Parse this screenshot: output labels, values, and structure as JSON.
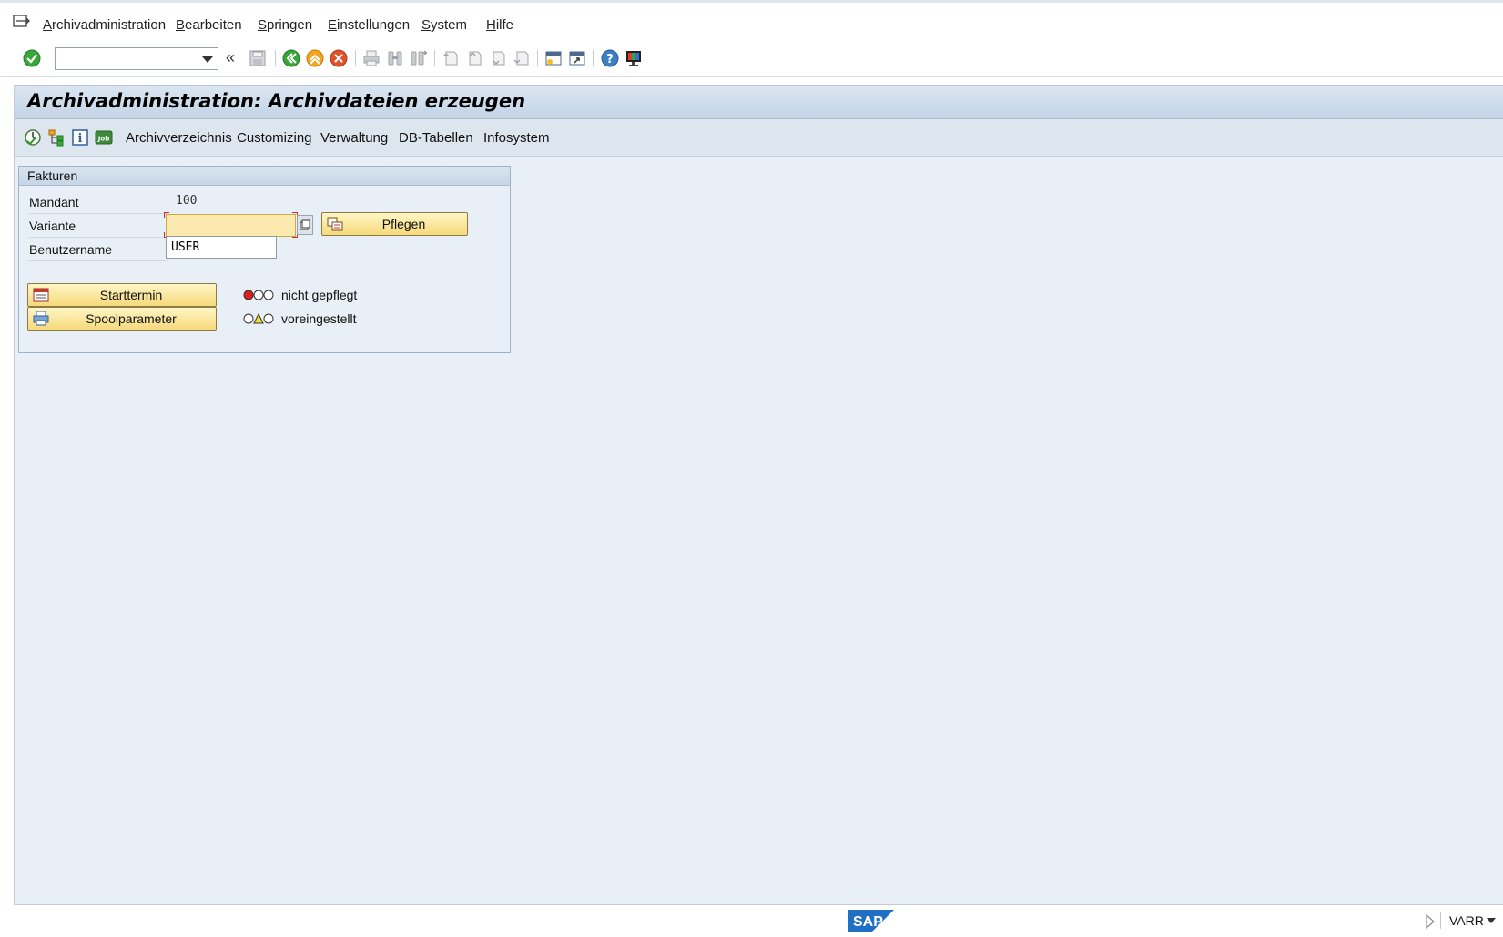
{
  "menu": {
    "items": [
      {
        "first": "A",
        "rest": "rchivadministration"
      },
      {
        "first": "B",
        "rest": "earbeiten"
      },
      {
        "first": "S",
        "rest": "pringen"
      },
      {
        "first": "E",
        "rest": "instellungen"
      },
      {
        "first": "S",
        "rest": "ystem"
      },
      {
        "first": "H",
        "rest": "ilfe"
      }
    ]
  },
  "system_toolbar": {
    "command_value": "",
    "collapse_glyph": "«"
  },
  "page": {
    "title": "Archivadministration: Archivdateien erzeugen"
  },
  "app_toolbar": {
    "links": [
      "Archivverzeichnis",
      "Customizing",
      "Verwaltung",
      "DB-Tabellen",
      "Infosystem"
    ]
  },
  "group": {
    "title": "Fakturen",
    "mandant_label": "Mandant",
    "mandant_value": "100",
    "variante_label": "Variante",
    "variante_value": "",
    "benutzer_label": "Benutzername",
    "benutzer_value": "USER",
    "pflegen_label": "Pflegen",
    "starttermin_label": "Starttermin",
    "starttermin_status": "nicht gepflegt",
    "spool_label": "Spoolparameter",
    "spool_status": "voreingestellt"
  },
  "status_bar": {
    "logo_text": "SAP",
    "transaction": "VARR"
  },
  "colors": {
    "title_gradient_top": "#dbe6f1",
    "main_background": "#e8eff6",
    "button_yellow": "#f6d97a",
    "required_field": "#fce9b0",
    "traffic_red": "#e02020",
    "traffic_yellow": "#f2e12a"
  }
}
